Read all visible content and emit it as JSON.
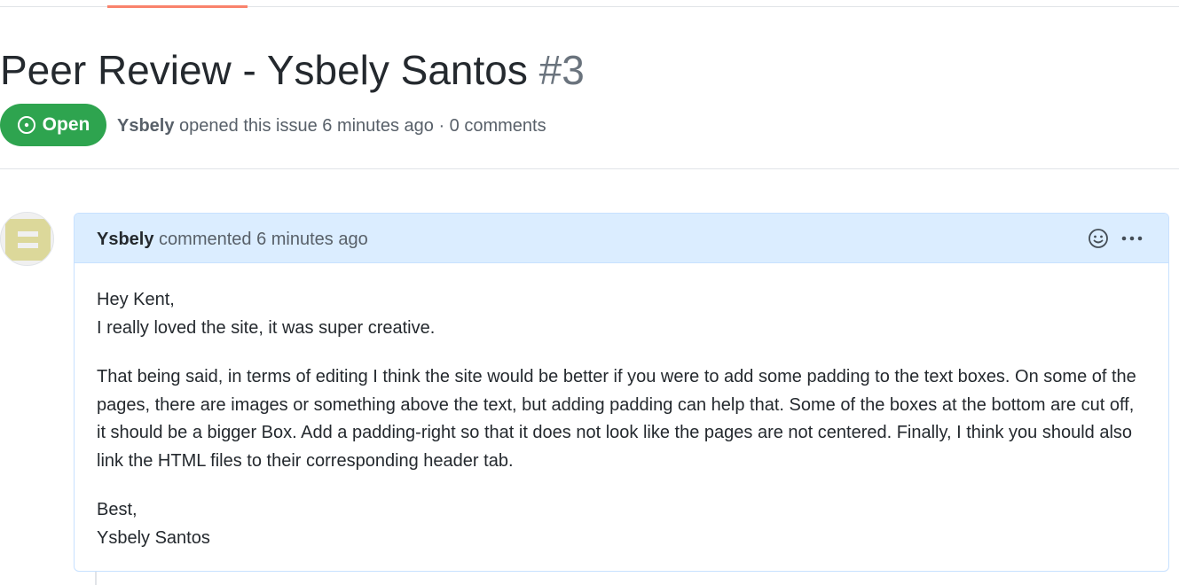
{
  "issue": {
    "title": "Peer Review - Ysbely Santos",
    "number": "#3",
    "state": "Open",
    "author": "Ysbely",
    "opened_text": "opened this issue 6 minutes ago · 0 comments"
  },
  "comment": {
    "author": "Ysbely",
    "meta": "commented 6 minutes ago",
    "body": {
      "greeting": "Hey Kent,",
      "line2": "I really loved the site, it was super creative.",
      "paragraph2": "That being said, in terms of editing I think the site would be better if you were to add some padding to the text boxes. On some of the pages, there are images or something above the text, but adding padding can help that. Some of the boxes at the bottom are cut off, it should be a bigger Box. Add a padding-right so that it does not look like the pages are not centered. Finally, I think you should also link the HTML files to their corresponding header tab.",
      "closing": "Best,",
      "signature": "Ysbely Santos"
    },
    "actions": {
      "reaction_icon": "smiley-icon",
      "more_icon": "kebab-horizontal-icon"
    }
  },
  "colors": {
    "open_badge": "#2ea44f",
    "header_bg": "#dbedff",
    "border": "#c8e1ff",
    "accent_tab": "#f9826c"
  }
}
